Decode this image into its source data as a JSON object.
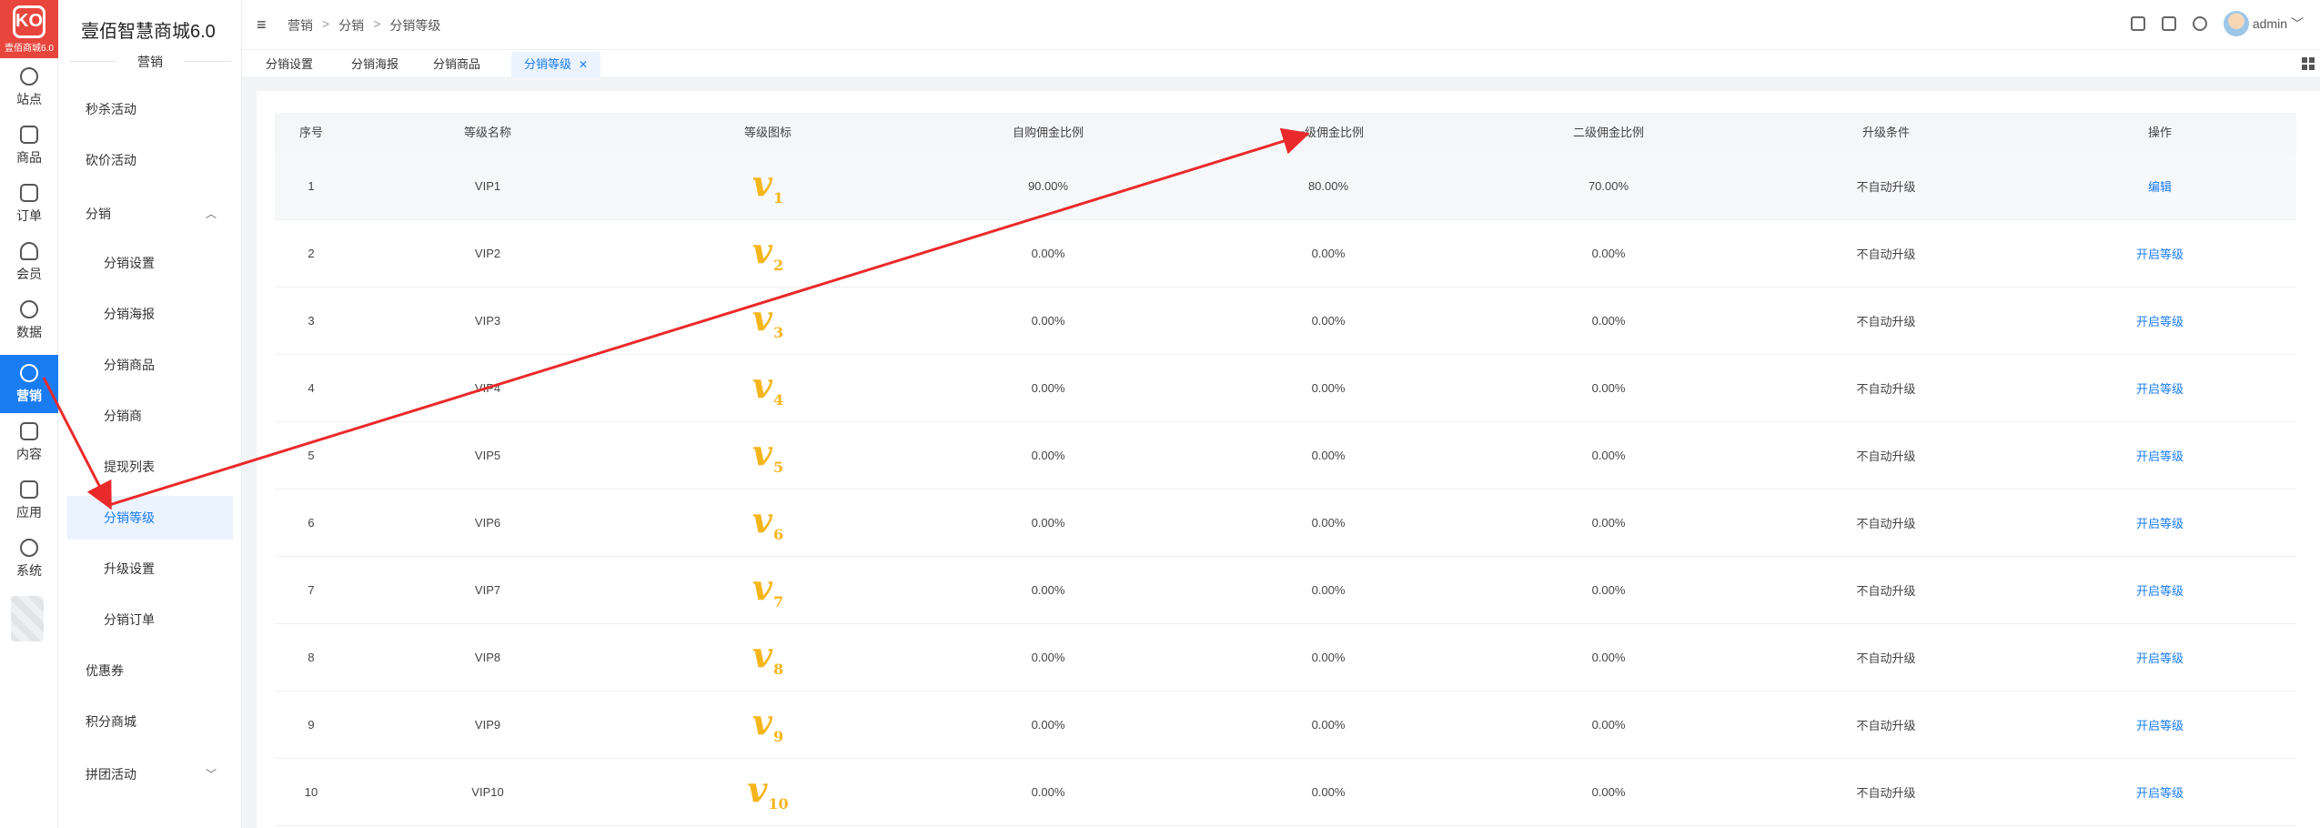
{
  "rail": {
    "logo_sub": "壹佰商城6.0",
    "items": [
      {
        "label": "站点",
        "icon": "globe-icon"
      },
      {
        "label": "商品",
        "icon": "cube-icon"
      },
      {
        "label": "订单",
        "icon": "clipboard-icon"
      },
      {
        "label": "会员",
        "icon": "user-icon"
      },
      {
        "label": "数据",
        "icon": "pie-icon"
      },
      {
        "label": "营销",
        "icon": "target-icon"
      },
      {
        "label": "内容",
        "icon": "folder-icon"
      },
      {
        "label": "应用",
        "icon": "box-icon"
      },
      {
        "label": "系统",
        "icon": "gear-icon"
      }
    ]
  },
  "menu": {
    "title": "壹佰智慧商城6.0",
    "section": "营销",
    "items": [
      {
        "label": "秒杀活动"
      },
      {
        "label": "砍价活动"
      },
      {
        "label": "分销"
      },
      {
        "label": "分销设置"
      },
      {
        "label": "分销海报"
      },
      {
        "label": "分销商品"
      },
      {
        "label": "分销商"
      },
      {
        "label": "提现列表"
      },
      {
        "label": "分销等级"
      },
      {
        "label": "升级设置"
      },
      {
        "label": "分销订单"
      },
      {
        "label": "优惠券"
      },
      {
        "label": "积分商城"
      },
      {
        "label": "拼团活动"
      }
    ]
  },
  "breadcrumb": [
    "营销",
    ">",
    "分销",
    ">",
    "分销等级"
  ],
  "user": {
    "name": "admin"
  },
  "tabs": [
    "分销设置",
    "分销海报",
    "分销商品",
    "分销等级"
  ],
  "table": {
    "headers": [
      "序号",
      "等级名称",
      "等级图标",
      "自购佣金比例",
      "一级佣金比例",
      "二级佣金比例",
      "升级条件",
      "操作"
    ],
    "rows": [
      {
        "no": "1",
        "name": "VIP1",
        "badge": "1",
        "self": "90.00%",
        "l1": "80.00%",
        "l2": "70.00%",
        "cond": "不自动升级",
        "op": "编辑"
      },
      {
        "no": "2",
        "name": "VIP2",
        "badge": "2",
        "self": "0.00%",
        "l1": "0.00%",
        "l2": "0.00%",
        "cond": "不自动升级",
        "op": "开启等级"
      },
      {
        "no": "3",
        "name": "VIP3",
        "badge": "3",
        "self": "0.00%",
        "l1": "0.00%",
        "l2": "0.00%",
        "cond": "不自动升级",
        "op": "开启等级"
      },
      {
        "no": "4",
        "name": "VIP4",
        "badge": "4",
        "self": "0.00%",
        "l1": "0.00%",
        "l2": "0.00%",
        "cond": "不自动升级",
        "op": "开启等级"
      },
      {
        "no": "5",
        "name": "VIP5",
        "badge": "5",
        "self": "0.00%",
        "l1": "0.00%",
        "l2": "0.00%",
        "cond": "不自动升级",
        "op": "开启等级"
      },
      {
        "no": "6",
        "name": "VIP6",
        "badge": "6",
        "self": "0.00%",
        "l1": "0.00%",
        "l2": "0.00%",
        "cond": "不自动升级",
        "op": "开启等级"
      },
      {
        "no": "7",
        "name": "VIP7",
        "badge": "7",
        "self": "0.00%",
        "l1": "0.00%",
        "l2": "0.00%",
        "cond": "不自动升级",
        "op": "开启等级"
      },
      {
        "no": "8",
        "name": "VIP8",
        "badge": "8",
        "self": "0.00%",
        "l1": "0.00%",
        "l2": "0.00%",
        "cond": "不自动升级",
        "op": "开启等级"
      },
      {
        "no": "9",
        "name": "VIP9",
        "badge": "9",
        "self": "0.00%",
        "l1": "0.00%",
        "l2": "0.00%",
        "cond": "不自动升级",
        "op": "开启等级"
      },
      {
        "no": "10",
        "name": "VIP10",
        "badge": "10",
        "self": "0.00%",
        "l1": "0.00%",
        "l2": "0.00%",
        "cond": "不自动升级",
        "op": "开启等级"
      }
    ]
  },
  "colors": {
    "accent": "#1a7cf3",
    "badge": "#f5b51b",
    "annotation": "#ea2a2a",
    "logo": "#e8463d"
  }
}
